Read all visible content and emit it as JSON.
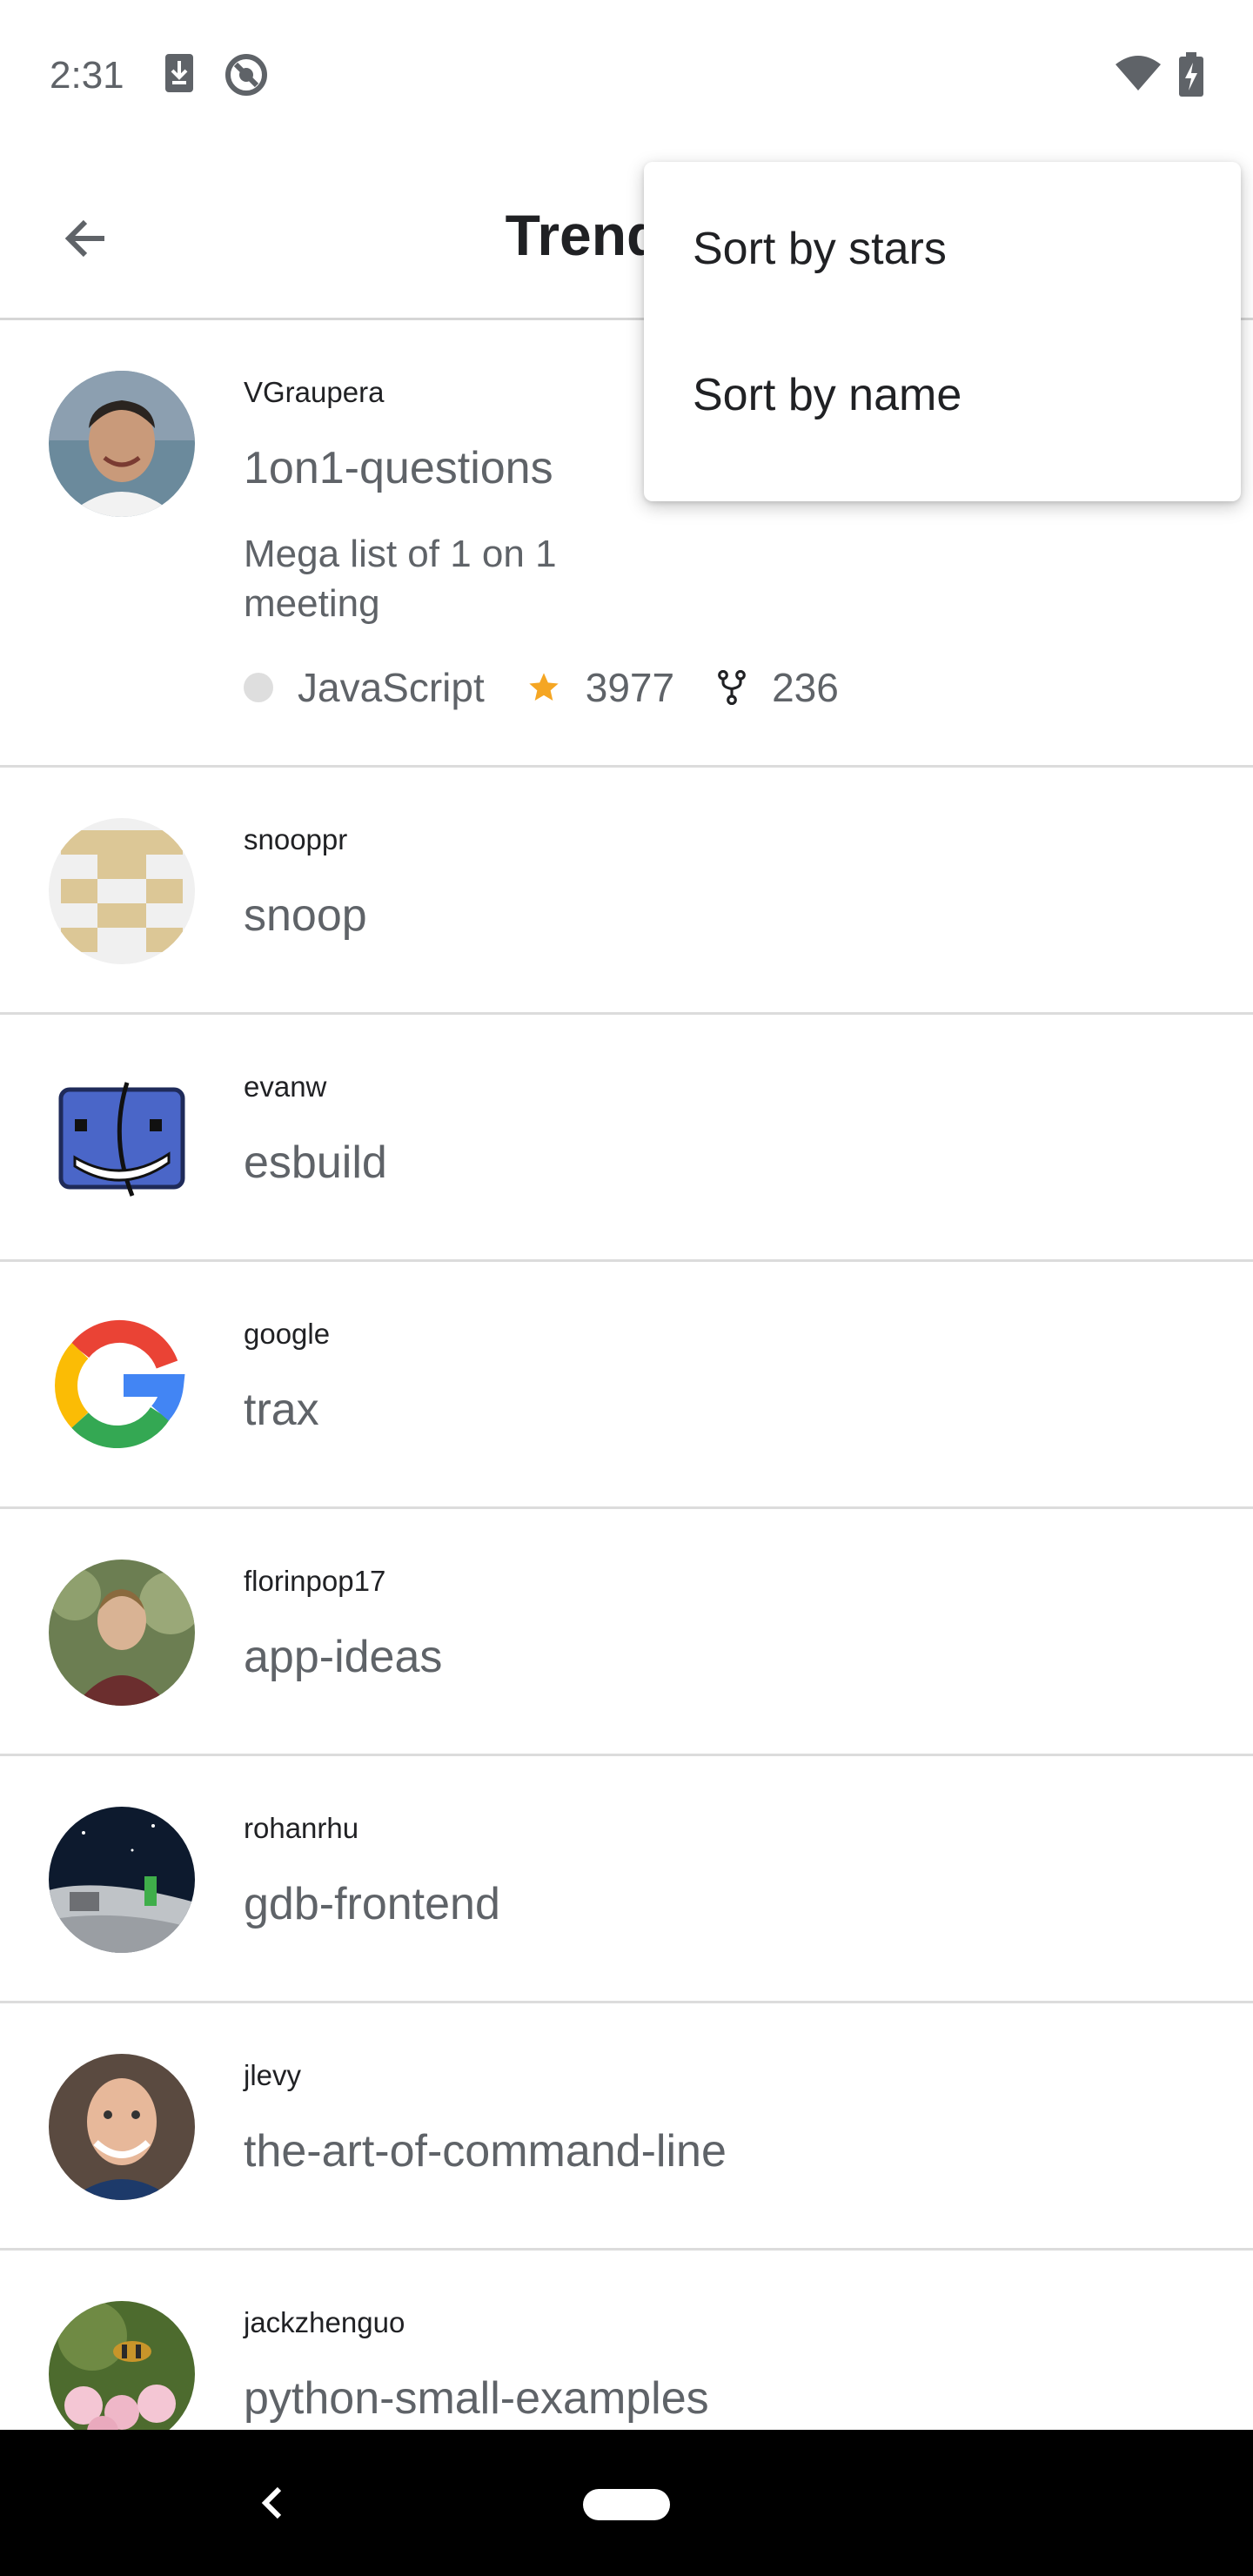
{
  "status_bar": {
    "time": "2:31",
    "icons": [
      "download-icon",
      "do-not-disturb-icon",
      "wifi-icon",
      "battery-charging-icon"
    ]
  },
  "app_bar": {
    "title": "Trending",
    "back_icon": "arrow-back-icon"
  },
  "menu": {
    "items": [
      {
        "label": "Sort by stars"
      },
      {
        "label": "Sort by name"
      }
    ]
  },
  "repos": [
    {
      "owner": "VGraupera",
      "name": "1on1-questions",
      "description": "Mega list of 1 on 1 meeting",
      "language": "JavaScript",
      "stars": "3977",
      "forks": "236"
    },
    {
      "owner": "snooppr",
      "name": "snoop"
    },
    {
      "owner": "evanw",
      "name": "esbuild"
    },
    {
      "owner": "google",
      "name": "trax"
    },
    {
      "owner": "florinpop17",
      "name": "app-ideas"
    },
    {
      "owner": "rohanrhu",
      "name": "gdb-frontend"
    },
    {
      "owner": "jlevy",
      "name": "the-art-of-command-line"
    },
    {
      "owner": "jackzhenguo",
      "name": "python-small-examples"
    }
  ],
  "colors": {
    "star": "#f5a623",
    "language_dot": "#dedede",
    "divider": "#dcdcdc",
    "nav_bar": "#000000"
  }
}
